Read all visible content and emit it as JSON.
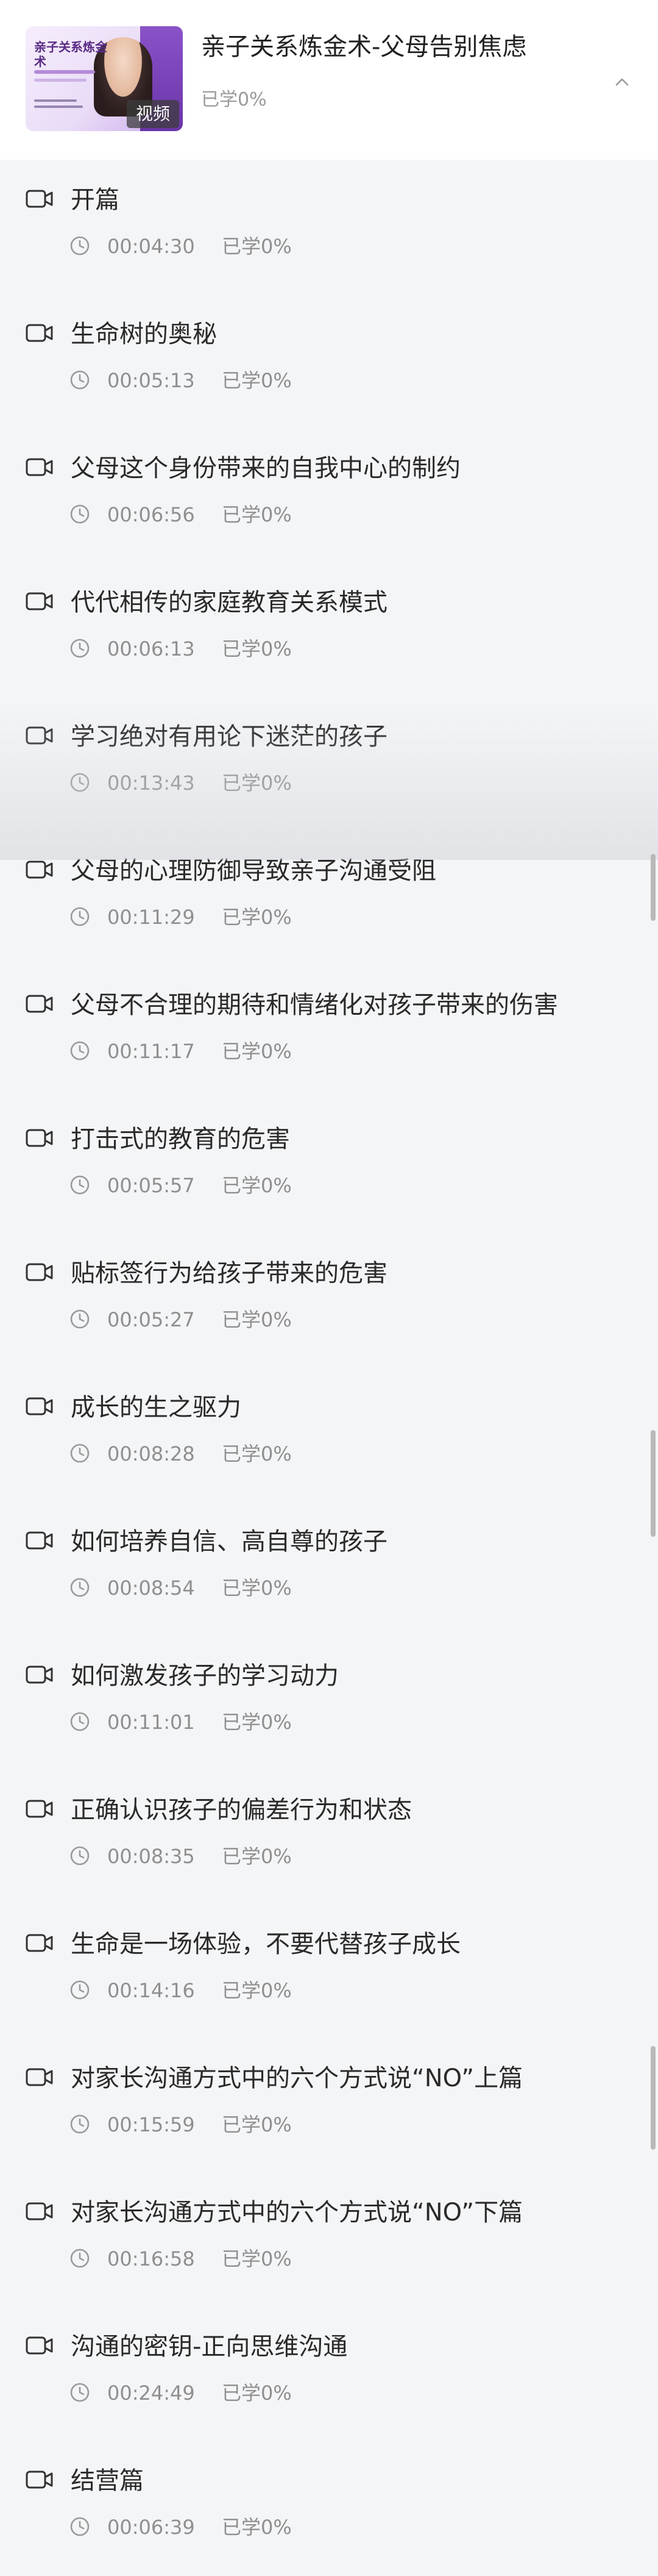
{
  "header": {
    "course_title": "亲子关系炼金术-父母告别焦虑",
    "course_progress": "已学0%",
    "cover_badge": "视频",
    "cover_text": "亲子关系炼金术"
  },
  "lessons": [
    {
      "title": "开篇",
      "duration": "00:04:30",
      "progress": "已学0%"
    },
    {
      "title": "生命树的奥秘",
      "duration": "00:05:13",
      "progress": "已学0%"
    },
    {
      "title": "父母这个身份带来的自我中心的制约",
      "duration": "00:06:56",
      "progress": "已学0%"
    },
    {
      "title": "代代相传的家庭教育关系模式",
      "duration": "00:06:13",
      "progress": "已学0%"
    },
    {
      "title": "学习绝对有用论下迷茫的孩子",
      "duration": "00:13:43",
      "progress": "已学0%"
    },
    {
      "title": "父母的心理防御导致亲子沟通受阻",
      "duration": "00:11:29",
      "progress": "已学0%"
    },
    {
      "title": "父母不合理的期待和情绪化对孩子带来的伤害",
      "duration": "00:11:17",
      "progress": "已学0%"
    },
    {
      "title": "打击式的教育的危害",
      "duration": "00:05:57",
      "progress": "已学0%"
    },
    {
      "title": "贴标签行为给孩子带来的危害",
      "duration": "00:05:27",
      "progress": "已学0%"
    },
    {
      "title": "成长的生之驱力",
      "duration": "00:08:28",
      "progress": "已学0%"
    },
    {
      "title": "如何培养自信、高自尊的孩子",
      "duration": "00:08:54",
      "progress": "已学0%"
    },
    {
      "title": "如何激发孩子的学习动力",
      "duration": "00:11:01",
      "progress": "已学0%"
    },
    {
      "title": "正确认识孩子的偏差行为和状态",
      "duration": "00:08:35",
      "progress": "已学0%"
    },
    {
      "title": "生命是一场体验，不要代替孩子成长",
      "duration": "00:14:16",
      "progress": "已学0%"
    },
    {
      "title": "对家长沟通方式中的六个方式说“NO”上篇",
      "duration": "00:15:59",
      "progress": "已学0%"
    },
    {
      "title": "对家长沟通方式中的六个方式说“NO”下篇",
      "duration": "00:16:58",
      "progress": "已学0%"
    },
    {
      "title": "沟通的密钥-正向思维沟通",
      "duration": "00:24:49",
      "progress": "已学0%"
    },
    {
      "title": "结营篇",
      "duration": "00:06:39",
      "progress": "已学0%"
    }
  ],
  "icons": {
    "lesson_type": "video-camera-icon",
    "duration": "clock-icon",
    "collapse": "chevron-up-icon"
  },
  "colors": {
    "background": "#f4f5f7",
    "header_background": "#ffffff",
    "title_text": "#2a2a2a",
    "meta_text": "#8f8f8f",
    "cover_accent": "#7b43b8"
  }
}
